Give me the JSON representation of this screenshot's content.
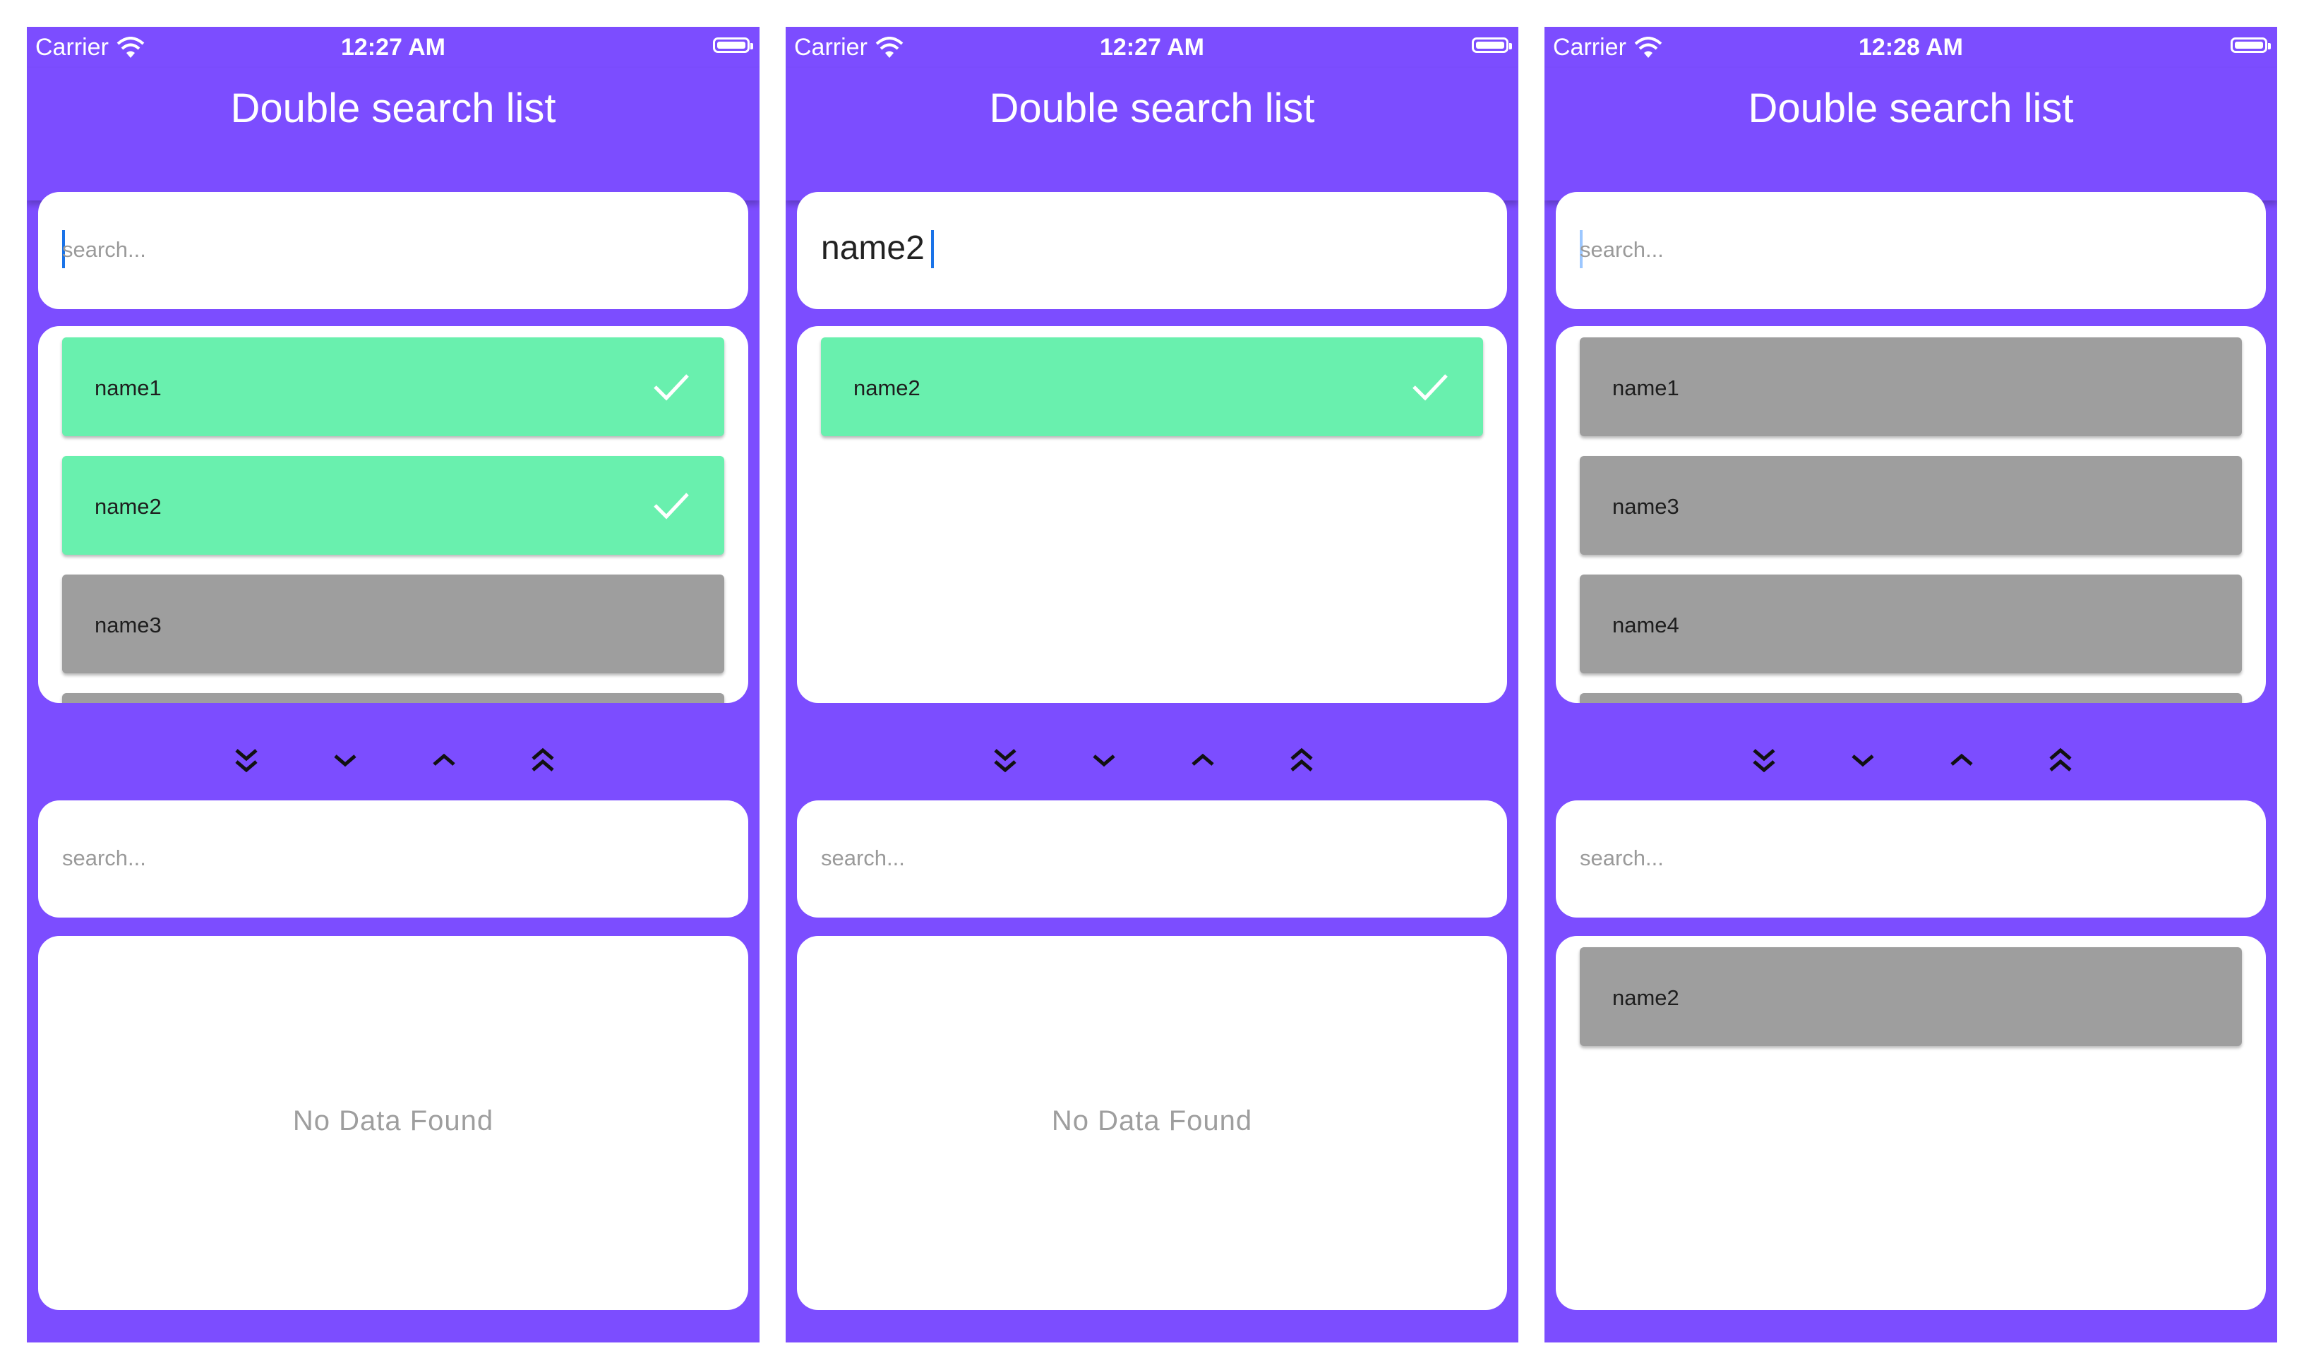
{
  "screens": [
    {
      "status": {
        "carrier": "Carrier",
        "time": "12:27 AM"
      },
      "title": "Double search list",
      "top_search": {
        "placeholder": "search...",
        "value": ""
      },
      "top_list": [
        {
          "label": "name1",
          "selected": true
        },
        {
          "label": "name2",
          "selected": true
        },
        {
          "label": "name3",
          "selected": false
        }
      ],
      "bottom_search": {
        "placeholder": "search...",
        "value": ""
      },
      "bottom_list": [],
      "empty_text": "No Data Found"
    },
    {
      "status": {
        "carrier": "Carrier",
        "time": "12:27 AM"
      },
      "title": "Double search list",
      "top_search": {
        "placeholder": "search...",
        "value": "name2"
      },
      "top_list": [
        {
          "label": "name2",
          "selected": true
        }
      ],
      "bottom_search": {
        "placeholder": "search...",
        "value": ""
      },
      "bottom_list": [],
      "empty_text": "No Data Found"
    },
    {
      "status": {
        "carrier": "Carrier",
        "time": "12:28 AM"
      },
      "title": "Double search list",
      "top_search": {
        "placeholder": "search...",
        "value": ""
      },
      "top_list": [
        {
          "label": "name1",
          "selected": false
        },
        {
          "label": "name3",
          "selected": false
        },
        {
          "label": "name4",
          "selected": false
        }
      ],
      "bottom_search": {
        "placeholder": "search...",
        "value": ""
      },
      "bottom_list": [
        {
          "label": "name2",
          "selected": false
        }
      ],
      "empty_text": ""
    }
  ],
  "nav_buttons": [
    "chevrons-down-icon",
    "chevron-down-icon",
    "chevron-up-icon",
    "chevrons-up-icon"
  ],
  "colors": {
    "primary": "#7c4dff",
    "selected": "#69f0ae",
    "unselected": "#9e9e9e"
  }
}
